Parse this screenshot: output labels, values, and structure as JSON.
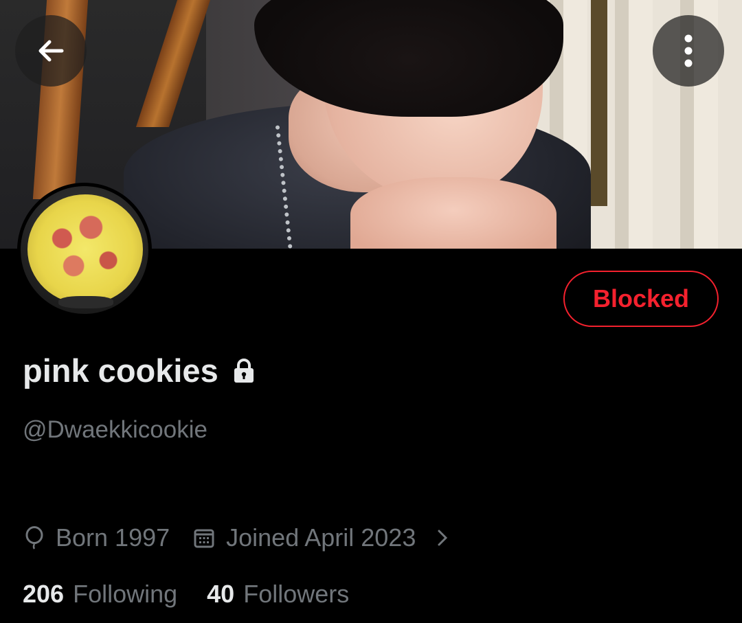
{
  "header": {
    "back_icon": "arrow-left-icon",
    "more_icon": "more-vertical-icon"
  },
  "profile": {
    "display_name": "pink cookies",
    "protected_icon": "lock-icon",
    "handle": "@Dwaekkicookie",
    "block_button_label": "Blocked",
    "born": "Born 1997",
    "joined": "Joined April 2023",
    "following_count": "206",
    "following_label": "Following",
    "followers_count": "40",
    "followers_label": "Followers"
  },
  "colors": {
    "background": "#000000",
    "primary_text": "#e7e9ea",
    "secondary_text": "#71767b",
    "blocked_red": "#f4212e"
  }
}
